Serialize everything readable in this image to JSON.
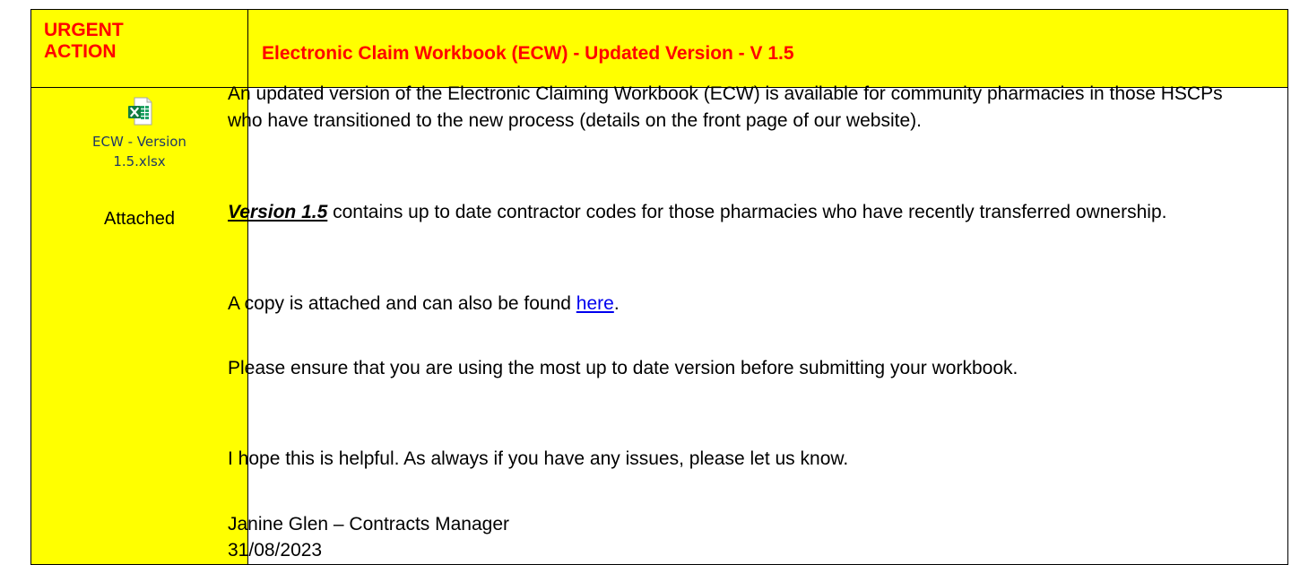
{
  "header": {
    "urgent_line1": "URGENT",
    "urgent_line2": "ACTION",
    "title": "Electronic Claim Workbook (ECW) - Updated Version - V 1.5"
  },
  "attachment": {
    "icon": "excel-file-icon",
    "file_name_line1": "ECW - Version",
    "file_name_line2": "1.5.xlsx",
    "status": "Attached"
  },
  "content": {
    "para1": "An updated version of the Electronic Claiming Workbook (ECW) is available for community pharmacies in those HSCPs who have transitioned to the new process (details on the front page of our website).",
    "version_label": "Version 1.5",
    "para2_rest": " contains up to date contractor codes for those pharmacies who have recently transferred ownership.",
    "para3_before": "A copy is attached and can also be found ",
    "para3_link": "here",
    "para3_after": ".",
    "para4": "Please ensure that you are using the most up to date version before submitting your workbook.",
    "para5": "I hope this is helpful.  As always if you have any issues, please let us know.",
    "signature": "Janine Glen – Contracts Manager",
    "date": "31/08/2023"
  },
  "colors": {
    "highlight": "#ffff00",
    "urgent_text": "#ff0000",
    "link": "#0000ee"
  }
}
